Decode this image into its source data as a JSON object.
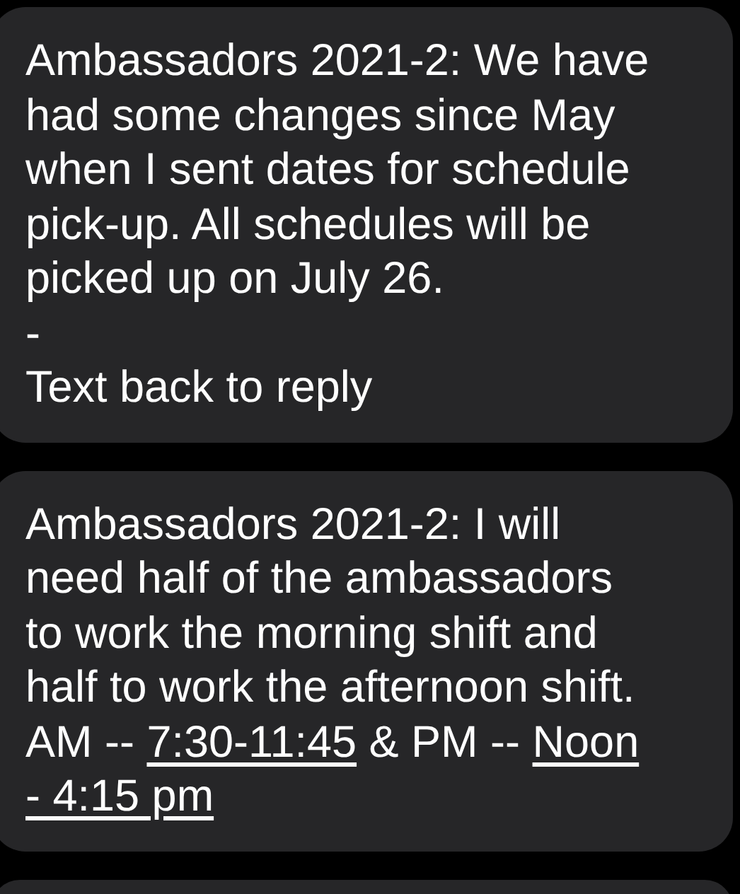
{
  "messages": [
    {
      "kind": "full",
      "lines": [
        [
          {
            "kind": "text",
            "text": "Ambassadors 2021-2: We have"
          }
        ],
        [
          {
            "kind": "text",
            "text": "had some changes since May"
          }
        ],
        [
          {
            "kind": "text",
            "text": "when I sent dates for schedule"
          }
        ],
        [
          {
            "kind": "text",
            "text": "pick-up. All schedules will be"
          }
        ],
        [
          {
            "kind": "text",
            "text": "picked up on July 26."
          }
        ],
        [
          {
            "kind": "text",
            "text": "-"
          }
        ],
        [
          {
            "kind": "text",
            "text": "Text back to reply"
          }
        ]
      ]
    },
    {
      "kind": "full",
      "lines": [
        [
          {
            "kind": "text",
            "text": "Ambassadors 2021-2: I will"
          }
        ],
        [
          {
            "kind": "text",
            "text": "need half of the ambassadors"
          }
        ],
        [
          {
            "kind": "text",
            "text": "to work the morning shift and"
          }
        ],
        [
          {
            "kind": "text",
            "text": "half to work the afternoon shift."
          }
        ],
        [
          {
            "kind": "text",
            "text": "AM -- "
          },
          {
            "kind": "link",
            "text": "7:30-11:45"
          },
          {
            "kind": "text",
            "text": " & PM -- "
          },
          {
            "kind": "link",
            "text": "Noon"
          }
        ],
        [
          {
            "kind": "link",
            "text": "- 4:15 pm"
          }
        ]
      ]
    },
    {
      "kind": "clipped"
    }
  ]
}
